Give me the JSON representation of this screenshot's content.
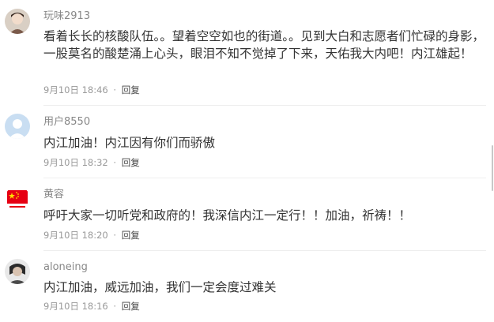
{
  "comments": [
    {
      "username": "玩味2913",
      "avatar_icon": "user-photo-avatar-icon",
      "content": "看着长长的核酸队伍。。望着空空如也的街道。。见到大白和志愿者们忙碌的身影，一股莫名的酸楚涌上心头，眼泪不知不觉掉了下来，天佑我大内吧！内江雄起！",
      "date": "9月10日",
      "time": "18:46",
      "separator": "·",
      "reply_label": "回复"
    },
    {
      "username": "用户8550",
      "avatar_icon": "default-user-avatar-icon",
      "content": "内江加油！内江因有你们而骄傲",
      "date": "9月10日",
      "time": "18:32",
      "separator": "·",
      "reply_label": "回复"
    },
    {
      "username": "黄容",
      "avatar_icon": "flag-avatar-icon",
      "content": "呼吁大家一切听党和政府的！我深信内江一定行！！加油，祈祷！！",
      "date": "9月10日",
      "time": "18:20",
      "separator": "·",
      "reply_label": "回复"
    },
    {
      "username": "aloneing",
      "avatar_icon": "user-photo-avatar-icon",
      "content": "内江加油，威远加油，我们一定会度过难关",
      "date": "9月10日",
      "time": "18:16",
      "separator": "·",
      "reply_label": "回复"
    }
  ],
  "colors": {
    "username": "#888888",
    "content": "#333333",
    "meta": "#999999",
    "divider": "#eeeeee",
    "flag_red": "#e60012",
    "default_avatar": "#b8d4ee"
  }
}
